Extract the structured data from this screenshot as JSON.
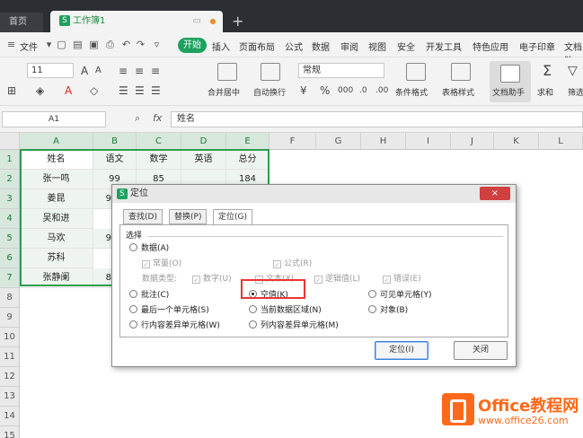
{
  "titlebar": {
    "tab_home": "首页",
    "tab_workbook": "工作簿1",
    "new_tab": "+"
  },
  "menubar": {
    "file": "文件",
    "items": [
      "开始",
      "插入",
      "页面布局",
      "公式",
      "数据",
      "审阅",
      "视图",
      "安全",
      "开发工具",
      "特色应用",
      "电子印章",
      "文档助"
    ]
  },
  "ribbon": {
    "font_size": "11",
    "number_format": "常规",
    "merge_center": "合并居中",
    "auto_wrap": "自动换行",
    "cond_format": "条件格式",
    "table_style": "表格样式",
    "doc_helper": "文档助手",
    "sum": "求和",
    "filter": "筛选"
  },
  "formula": {
    "name_box": "A1",
    "fx": "fx",
    "value": "姓名"
  },
  "sheet": {
    "columns": [
      "A",
      "B",
      "C",
      "D",
      "E",
      "F",
      "G",
      "H",
      "I",
      "J",
      "K",
      "L"
    ],
    "rows": [
      "1",
      "2",
      "3",
      "4",
      "5",
      "6",
      "7",
      "8",
      "9",
      "10",
      "11",
      "12",
      "13",
      "14",
      "15"
    ],
    "headers": [
      "姓名",
      "语文",
      "数学",
      "英语",
      "总分"
    ],
    "data": [
      [
        "张一鸣",
        "99",
        "85",
        "",
        "184"
      ],
      [
        "姜昆",
        "9",
        "",
        "",
        "",
        ""
      ],
      [
        "吴和进",
        "",
        "",
        "",
        "",
        ""
      ],
      [
        "马欢",
        "9",
        "",
        "",
        "",
        ""
      ],
      [
        "苏科",
        "",
        "",
        "",
        "",
        ""
      ],
      [
        "张静阑",
        "8",
        "",
        "",
        "",
        ""
      ]
    ]
  },
  "dialog": {
    "title": "定位",
    "close": "×",
    "tabs": [
      "查找(D)",
      "替换(P)",
      "定位(G)"
    ],
    "group": "选择",
    "data_opt": "数据(A)",
    "sub_const": "常量(O)",
    "sub_formula": "公式(R)",
    "data_type_label": "数据类型:",
    "type_number": "数字(U)",
    "type_text": "文本(X)",
    "type_logic": "逻辑值(L)",
    "type_error": "错误(E)",
    "opt_comment": "批注(C)",
    "opt_blank": "空值(K)",
    "opt_visible": "可见单元格(Y)",
    "opt_last": "最后一个单元格(S)",
    "opt_region": "当前数据区域(N)",
    "opt_object": "对象(B)",
    "opt_rowdiff": "行内容差异单元格(W)",
    "opt_coldiff": "列内容差异单元格(M)",
    "btn_locate": "定位(I)",
    "btn_close": "关闭"
  },
  "watermark": {
    "brand": "Office教程网",
    "url": "www.office26.com"
  },
  "colors": {
    "accent": "#1ea15f",
    "selection": "#2e9d4e",
    "highlight": "#e33333",
    "watermark": "#ff6a1a"
  }
}
